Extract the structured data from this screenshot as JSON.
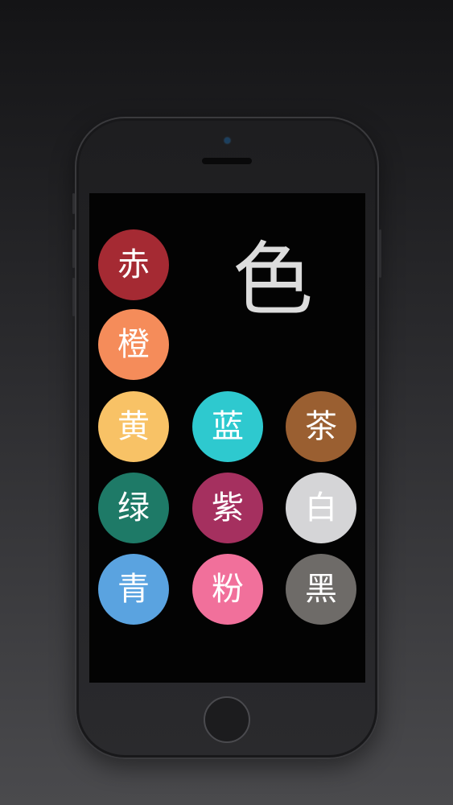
{
  "app": {
    "big_char": "色"
  },
  "colors": {
    "aka": {
      "label": "赤",
      "hex": "#a52a33"
    },
    "daidai": {
      "label": "橙",
      "hex": "#f58c5a"
    },
    "ki": {
      "label": "黄",
      "hex": "#f8c266"
    },
    "ai": {
      "label": "蓝",
      "hex": "#2ec9cf"
    },
    "cha": {
      "label": "茶",
      "hex": "#9a5f31"
    },
    "midori": {
      "label": "绿",
      "hex": "#1e7a67"
    },
    "murasaki": {
      "label": "紫",
      "hex": "#a5305f"
    },
    "shiro": {
      "label": "白",
      "hex": "#d5d5d7"
    },
    "ao": {
      "label": "青",
      "hex": "#5aa3e0"
    },
    "momo": {
      "label": "粉",
      "hex": "#f1709b"
    },
    "kuro": {
      "label": "黑",
      "hex": "#6e6b68"
    }
  }
}
